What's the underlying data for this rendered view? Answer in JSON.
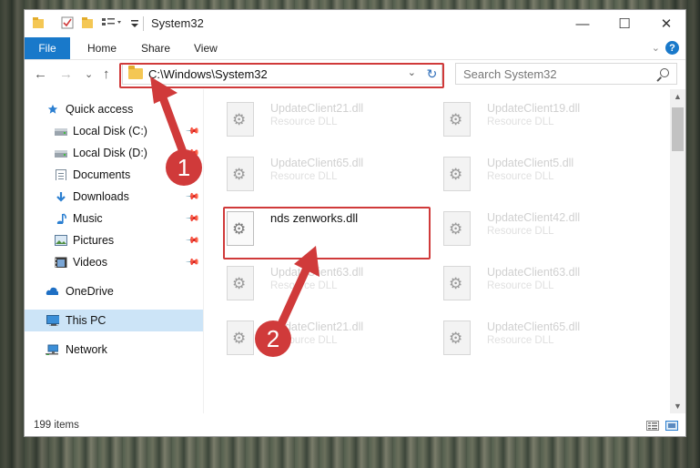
{
  "window": {
    "title": "System32",
    "minimize_glyph": "—",
    "maximize_glyph": "☐",
    "close_glyph": "✕"
  },
  "ribbon": {
    "tabs": [
      "File",
      "Home",
      "Share",
      "View"
    ],
    "help_glyph": "?",
    "collapse_glyph": "⌄"
  },
  "address_bar": {
    "path": "C:\\Windows\\System32",
    "dropdown_glyph": "⌄",
    "refresh_glyph": "↻",
    "back_glyph": "←",
    "forward_glyph": "→",
    "recent_glyph": "⌄",
    "up_glyph": "↑"
  },
  "search": {
    "placeholder": "Search System32"
  },
  "nav_pane": {
    "items": [
      {
        "label": "Quick access",
        "icon": "star-icon",
        "pinned": false
      },
      {
        "label": "Local Disk (C:)",
        "icon": "drive-icon",
        "pinned": true
      },
      {
        "label": "Local Disk (D:)",
        "icon": "drive-icon",
        "pinned": true
      },
      {
        "label": "Documents",
        "icon": "document-icon",
        "pinned": true
      },
      {
        "label": "Downloads",
        "icon": "download-icon",
        "pinned": true
      },
      {
        "label": "Music",
        "icon": "music-icon",
        "pinned": true
      },
      {
        "label": "Pictures",
        "icon": "pictures-icon",
        "pinned": true
      },
      {
        "label": "Videos",
        "icon": "videos-icon",
        "pinned": true
      },
      {
        "label": "OneDrive",
        "icon": "cloud-icon",
        "pinned": false
      },
      {
        "label": "This PC",
        "icon": "computer-icon",
        "pinned": false,
        "selected": true
      },
      {
        "label": "Network",
        "icon": "network-icon",
        "pinned": false
      }
    ]
  },
  "files": [
    {
      "name": "UpdateClient21.dll",
      "type": "Resource DLL"
    },
    {
      "name": "UpdateClient19.dll",
      "type": "Resource DLL"
    },
    {
      "name": "UpdateClient65.dll",
      "type": "Resource DLL"
    },
    {
      "name": "UpdateClient5.dll",
      "type": "Resource DLL"
    },
    {
      "name": "nds zenworks.dll",
      "type": "",
      "highlighted": true
    },
    {
      "name": "UpdateClient42.dll",
      "type": "Resource DLL"
    },
    {
      "name": "UpdateClient63.dll",
      "type": "Resource DLL"
    },
    {
      "name": "UpdateClient63.dll",
      "type": "Resource DLL"
    },
    {
      "name": "UpdateClient21.dll",
      "type": "Resource DLL"
    },
    {
      "name": "UpdateClient65.dll",
      "type": "Resource DLL"
    }
  ],
  "status": {
    "item_count": "199 items"
  },
  "annotations": {
    "step1": "1",
    "step2": "2",
    "color": "#d03a3a"
  }
}
